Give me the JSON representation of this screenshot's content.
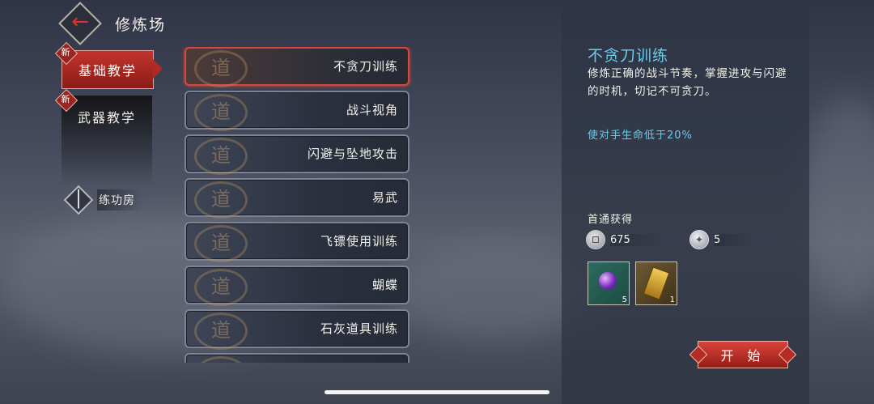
{
  "header": {
    "title": "修炼场"
  },
  "tabs": [
    {
      "label": "基础教学",
      "badge": "新",
      "active": true
    },
    {
      "label": "武器教学",
      "badge": "新",
      "active": false
    }
  ],
  "practice_room": {
    "label": "练功房"
  },
  "training_list": [
    {
      "label": "不贪刀训练",
      "selected": true
    },
    {
      "label": "战斗视角"
    },
    {
      "label": "闪避与坠地攻击"
    },
    {
      "label": "易武"
    },
    {
      "label": "飞镖使用训练"
    },
    {
      "label": "蝴蝶"
    },
    {
      "label": "石灰道具训练"
    },
    {
      "label": ""
    }
  ],
  "detail": {
    "title": "不贪刀训练",
    "description": "修炼正确的战斗节奏，掌握进攻与闪避的时机，切记不可贪刀。",
    "condition": "使对手生命低于20%",
    "reward_title": "首通获得",
    "currencies": [
      {
        "icon": "coin-icon",
        "value": "675"
      },
      {
        "icon": "medal-icon",
        "value": "5"
      }
    ],
    "items": [
      {
        "icon": "purple-orb-icon",
        "count": "5"
      },
      {
        "icon": "golden-scroll-icon",
        "count": "1"
      }
    ],
    "start_label": "开 始"
  },
  "colors": {
    "accent_red": "#c2342d",
    "info_cyan": "#6bcde9"
  }
}
